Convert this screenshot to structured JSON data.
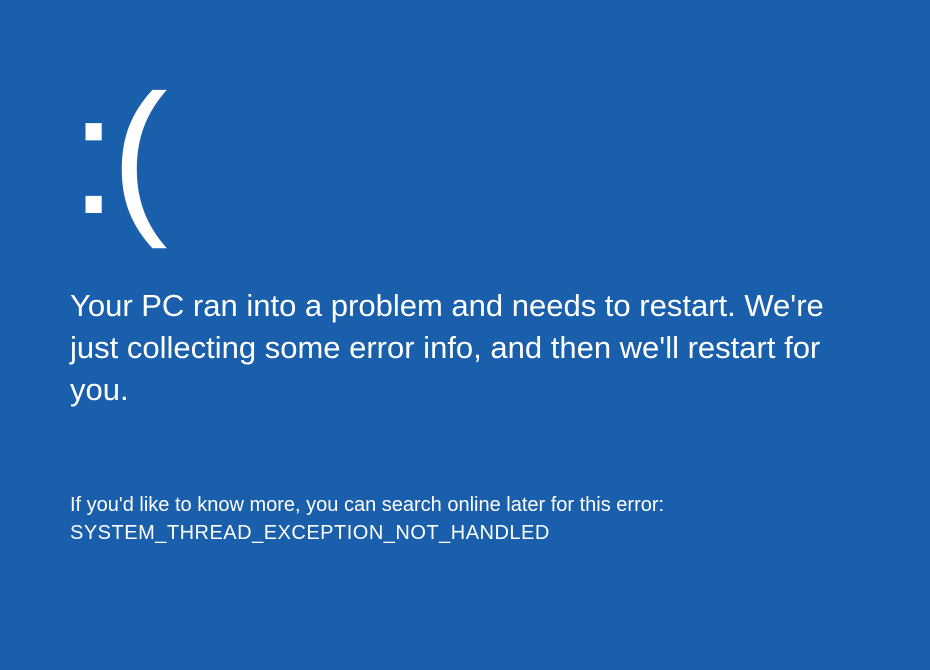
{
  "bsod": {
    "emoticon": ":(",
    "main_message": "Your PC ran into a problem and needs to restart. We're just collecting some error info, and then we'll restart for you.",
    "hint": "If you'd like to know more, you can search online later for this error:",
    "error_code": "SYSTEM_THREAD_EXCEPTION_NOT_HANDLED"
  }
}
